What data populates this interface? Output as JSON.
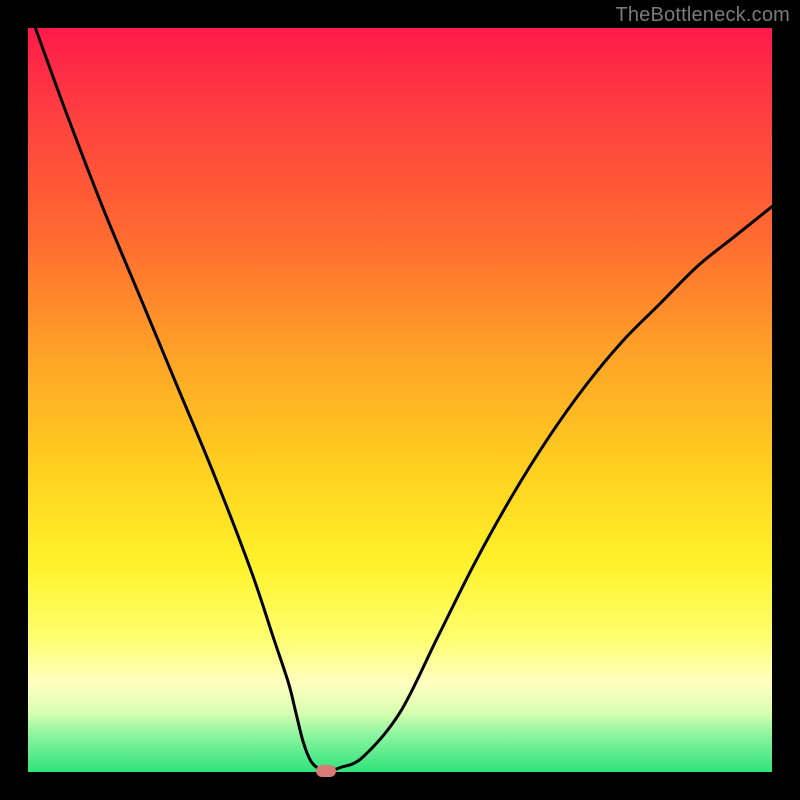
{
  "watermark": "TheBottleneck.com",
  "colors": {
    "frame": "#000000",
    "gradient_top": "#ff1a4a",
    "gradient_bottom": "#2fe37a",
    "curve": "#000000",
    "marker": "#d97a77"
  },
  "chart_data": {
    "type": "line",
    "title": "",
    "xlabel": "",
    "ylabel": "",
    "xlim": [
      0,
      100
    ],
    "ylim": [
      0,
      100
    ],
    "grid": false,
    "series": [
      {
        "name": "bottleneck-curve",
        "x": [
          1,
          5,
          10,
          15,
          20,
          25,
          30,
          33,
          35,
          36,
          37,
          38,
          39,
          40,
          41,
          42,
          45,
          50,
          55,
          60,
          65,
          70,
          75,
          80,
          85,
          90,
          95,
          100
        ],
        "values": [
          100,
          89,
          76,
          64,
          52,
          40,
          27,
          18,
          12,
          8,
          4,
          1.5,
          0.5,
          0.2,
          0.3,
          0.6,
          2,
          8,
          18,
          28,
          37,
          45,
          52,
          58,
          63,
          68,
          72,
          76
        ]
      }
    ],
    "marker": {
      "x": 40,
      "y": 0.2
    },
    "minimum_x": 40
  }
}
